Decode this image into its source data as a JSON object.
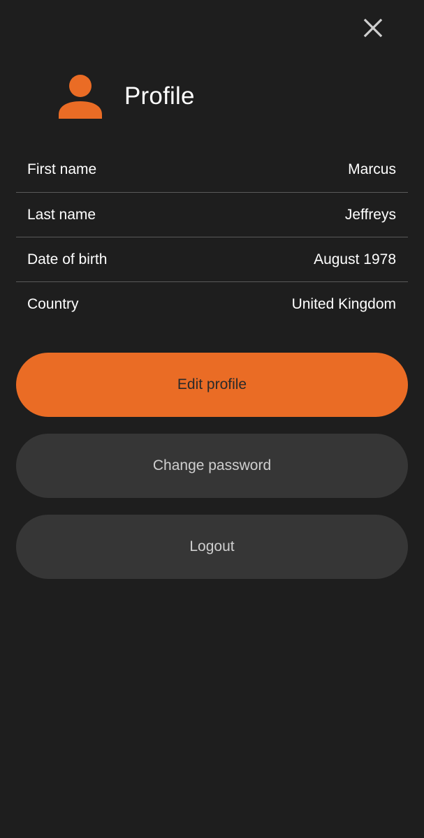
{
  "colors": {
    "background": "#1e1e1e",
    "accent": "#ea6c25",
    "secondary_button": "#363636",
    "divider": "#5a5a5a",
    "text": "#ffffff"
  },
  "header": {
    "icon": "person-icon",
    "title": "Profile"
  },
  "close": {
    "icon": "close-icon"
  },
  "profile": {
    "rows": [
      {
        "label": "First name",
        "value": "Marcus"
      },
      {
        "label": "Last name",
        "value": "Jeffreys"
      },
      {
        "label": "Date of birth",
        "value": "August 1978"
      },
      {
        "label": "Country",
        "value": "United Kingdom"
      }
    ]
  },
  "actions": {
    "edit_label": "Edit profile",
    "change_password_label": "Change password",
    "logout_label": "Logout"
  }
}
